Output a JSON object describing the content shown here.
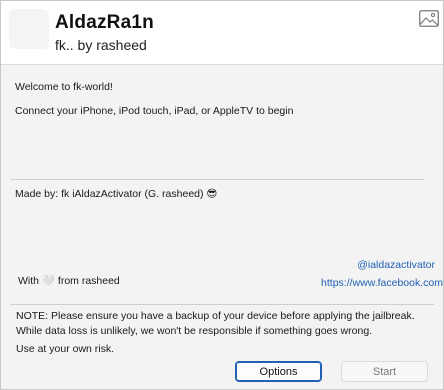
{
  "header": {
    "title": "AldazRa1n",
    "subtitle": "fk.. by rasheed"
  },
  "main": {
    "welcome": "Welcome to fk-world!",
    "connect": "Connect your iPhone, iPod touch, iPad, or AppleTV to begin",
    "made_by": "Made by: fk iAldazActivator (G. rasheed) 😎",
    "with_text": "With 🤍 from rasheed",
    "link_handle": "@ialdazactivator",
    "link_facebook": "https://www.facebook.com"
  },
  "note": {
    "line1": "NOTE: Please ensure you have a backup of your device before applying the jailbreak.",
    "line2": "While data loss is unlikely, we won't be responsible if something goes wrong.",
    "line3": "Use at your own risk."
  },
  "buttons": {
    "options_label": "Options",
    "start_label": "Start"
  },
  "icons": {
    "header_image": "image-icon"
  }
}
